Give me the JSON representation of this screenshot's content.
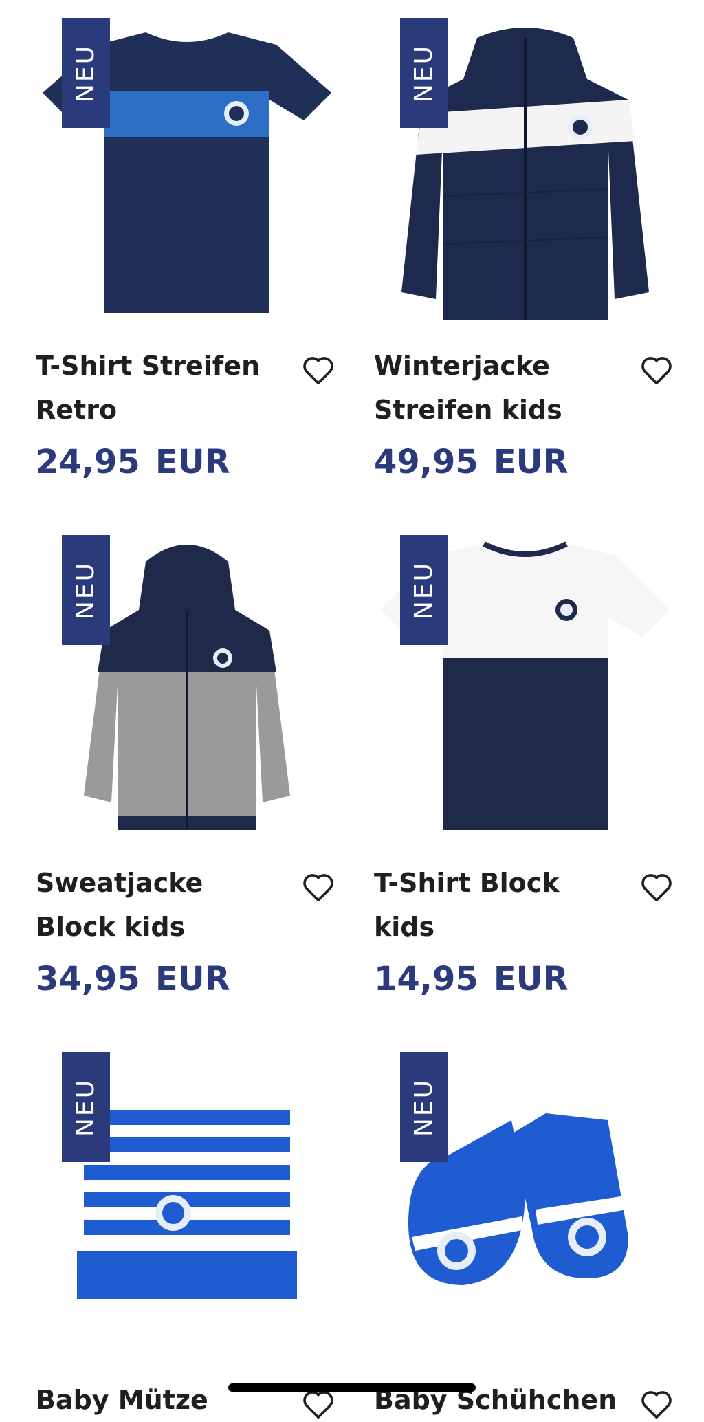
{
  "badge_label": "NEU",
  "colors": {
    "badge_bg": "#2b3a7a",
    "price": "#2b3a7a",
    "navy": "#1f2a4a",
    "royal_blue": "#1f5bd1",
    "light_gray": "#a9a9a9"
  },
  "products": [
    {
      "title": "T-Shirt Streifen Retro",
      "price": "24,95",
      "currency": "EUR",
      "image_icon": "tshirt-stripe-icon"
    },
    {
      "title": "Winterjacke Streifen kids",
      "price": "49,95",
      "currency": "EUR",
      "image_icon": "winter-jacket-icon"
    },
    {
      "title": "Sweatjacke Block kids",
      "price": "34,95",
      "currency": "EUR",
      "image_icon": "sweat-jacket-icon"
    },
    {
      "title": "T-Shirt Block kids",
      "price": "14,95",
      "currency": "EUR",
      "image_icon": "tshirt-block-icon"
    },
    {
      "title": "Baby Mütze",
      "image_icon": "baby-beanie-icon"
    },
    {
      "title": "Baby Schühchen",
      "image_icon": "baby-booties-icon"
    }
  ],
  "heart_icon": "heart-outline-icon"
}
